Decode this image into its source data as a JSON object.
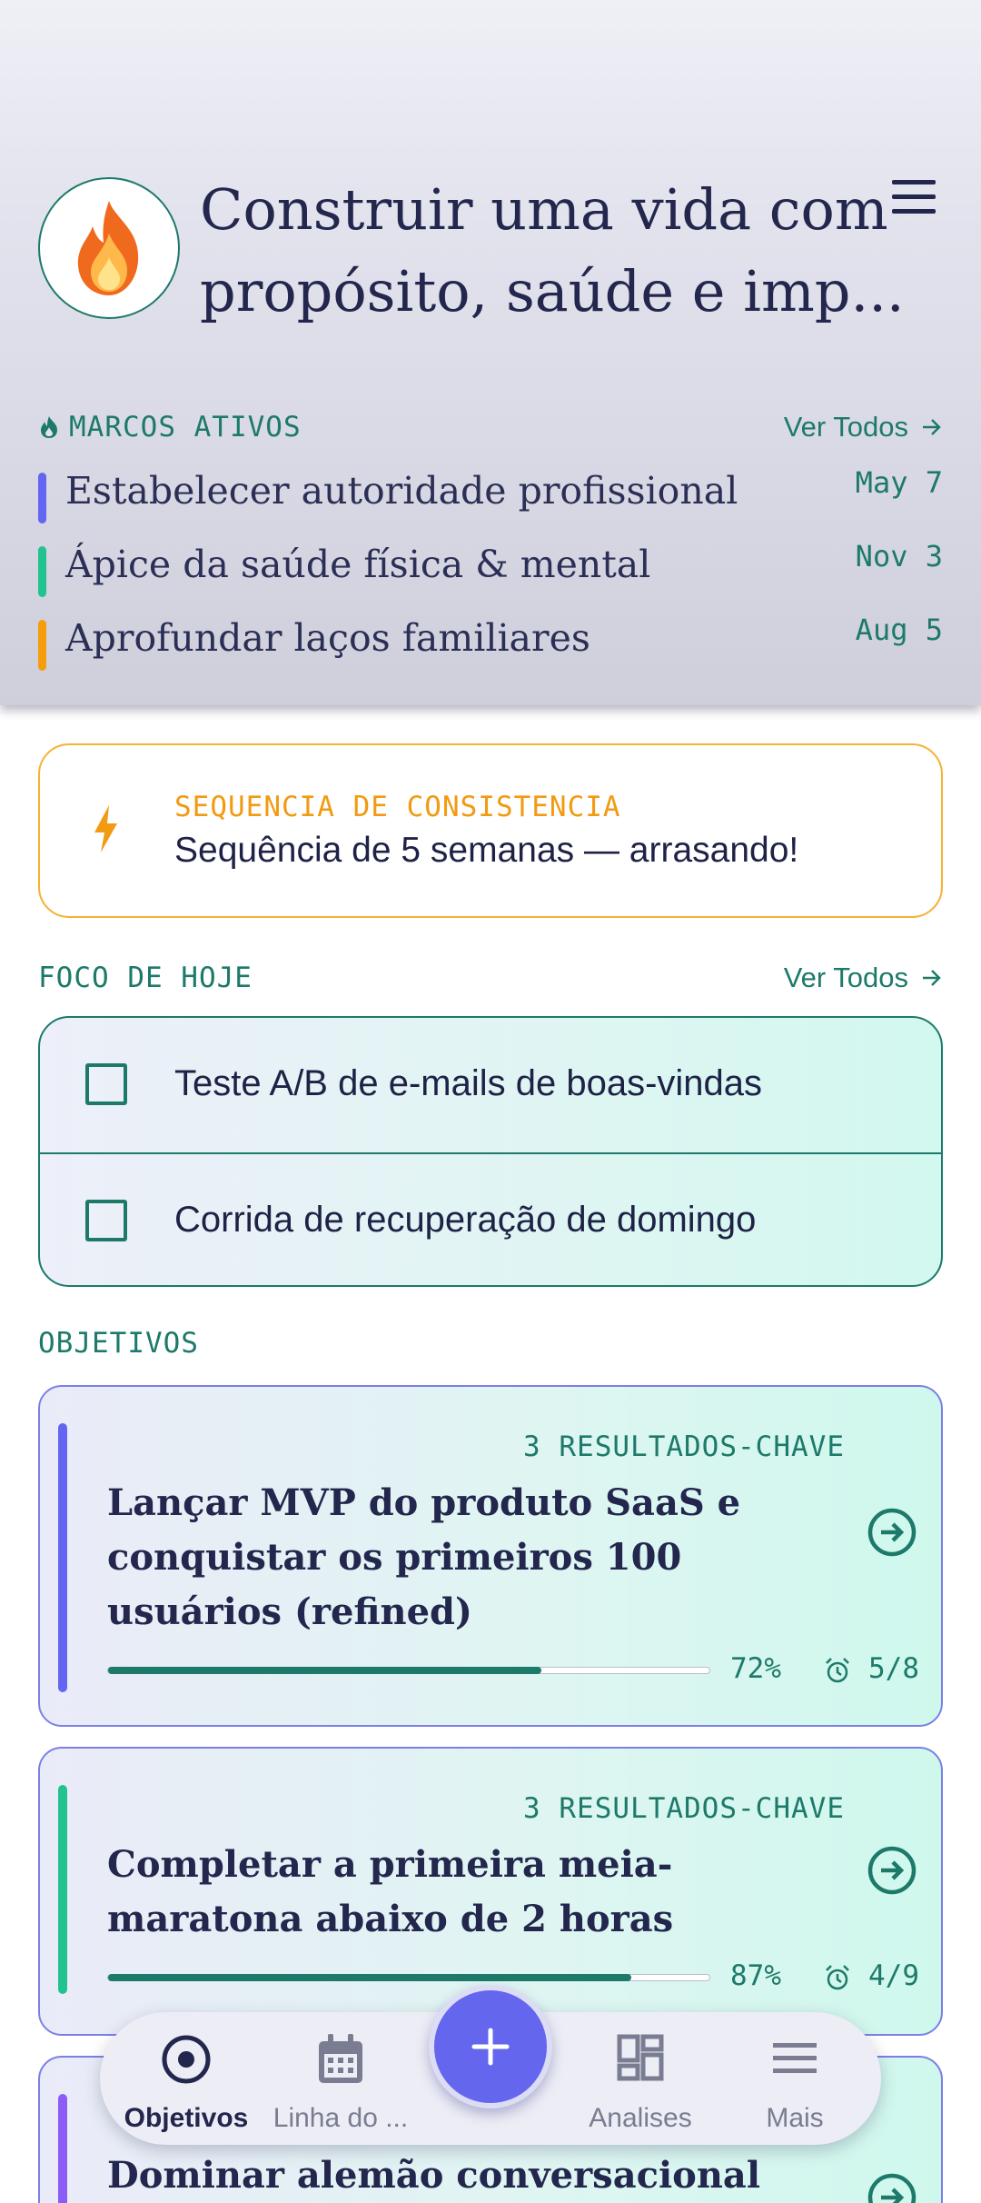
{
  "header": {
    "title_line1": "Construir uma vida com",
    "title_line2": "propósito, saúde e imp...",
    "avatar_icon": "flame-icon",
    "menu_icon": "hamburger-menu-icon"
  },
  "milestones": {
    "label": "MARCOS ATIVOS",
    "see_all": "Ver Todos",
    "items": [
      {
        "title": "Estabelecer autoridade profissional",
        "date": "May 7",
        "color": "#6366f1"
      },
      {
        "title": "Ápice da saúde física & mental",
        "date": "Nov 3",
        "color": "#22c38e"
      },
      {
        "title": "Aprofundar laços familiares",
        "date": "Aug 5",
        "color": "#f59e0b"
      }
    ]
  },
  "streak": {
    "label": "SEQUENCIA DE CONSISTENCIA",
    "text": "Sequência de 5 semanas — arrasando!",
    "icon": "lightning-icon",
    "color": "#f29a11"
  },
  "focus": {
    "label": "FOCO DE HOJE",
    "see_all": "Ver Todos",
    "tasks": [
      {
        "text": "Teste A/B de e-mails de boas-vindas",
        "checked": false
      },
      {
        "text": "Corrida de recuperação de domingo",
        "checked": false
      }
    ]
  },
  "objectives": {
    "label": "OBJETIVOS",
    "items": [
      {
        "kr": "3 RESULTADOS-CHAVE",
        "title": "Lançar MVP do produto SaaS e conquistar os primeiros 100 usuários (refined)",
        "progress": 72,
        "progress_label": "72%",
        "count": "5/8",
        "color": "#6366f1"
      },
      {
        "kr": "3 RESULTADOS-CHAVE",
        "title": "Completar a primeira meia-maratona abaixo de 2 horas",
        "progress": 87,
        "progress_label": "87%",
        "count": "4/9",
        "color": "#22c38e"
      },
      {
        "title": "Dominar alemão conversacional (nível",
        "color": "#8b5cf6"
      }
    ]
  },
  "nav": {
    "items": [
      {
        "label": "Objetivos",
        "icon": "target-icon",
        "active": true
      },
      {
        "label": "Linha do ...",
        "icon": "calendar-icon",
        "active": false
      },
      {
        "label": "Analises",
        "icon": "dashboard-icon",
        "active": false
      },
      {
        "label": "Mais",
        "icon": "menu-icon",
        "active": false
      }
    ],
    "fab_label": "+",
    "accent": "#6466ee"
  }
}
